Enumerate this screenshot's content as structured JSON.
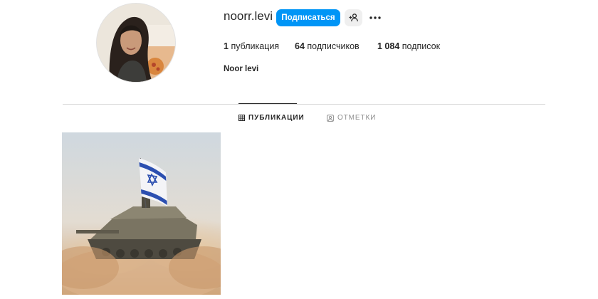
{
  "profile": {
    "username": "noorr.levi",
    "follow_label": "Подписаться",
    "full_name": "Noor levi",
    "avatar_icon": "profile-photo",
    "add_user_icon": "add-user-icon",
    "more_icon": "more-horizontal-icon"
  },
  "stats": {
    "posts_count": "1",
    "posts_label": "публикация",
    "followers_count": "64",
    "followers_label": "подписчиков",
    "following_count": "1 084",
    "following_label": "подписок"
  },
  "tabs": [
    {
      "label": "ПУБЛИКАЦИИ",
      "icon": "grid-icon",
      "active": true
    },
    {
      "label": "ОТМЕТКИ",
      "icon": "tagged-icon",
      "active": false
    }
  ],
  "colors": {
    "accent": "#0095f6",
    "text": "#262626",
    "muted": "#8e8e8e",
    "divider": "#dbdbdb"
  },
  "posts": [
    {
      "description_icon": "tank-with-flag-image"
    }
  ]
}
